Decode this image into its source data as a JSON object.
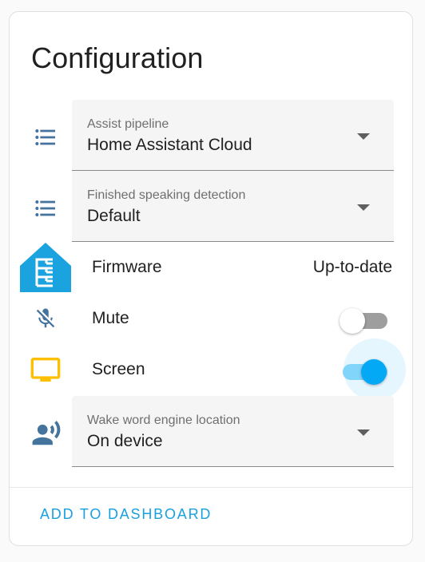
{
  "card": {
    "title": "Configuration"
  },
  "assist_pipeline": {
    "label": "Assist pipeline",
    "value": "Home Assistant Cloud",
    "icon": "format-list-bulleted-icon"
  },
  "finished_speaking": {
    "label": "Finished speaking detection",
    "value": "Default",
    "icon": "format-list-bulleted-icon"
  },
  "firmware": {
    "label": "Firmware",
    "value": "Up-to-date",
    "icon": "esphome-icon"
  },
  "mute": {
    "label": "Mute",
    "state": "off",
    "icon": "microphone-off-icon"
  },
  "screen": {
    "label": "Screen",
    "state": "on",
    "icon": "monitor-icon"
  },
  "wake_word": {
    "label": "Wake word engine location",
    "value": "On device",
    "icon": "account-voice-icon"
  },
  "actions": {
    "add_to_dashboard": "ADD TO DASHBOARD"
  },
  "colors": {
    "icon": "#44739e",
    "esphome": "#1ba3df",
    "screen_icon": "#fdbf00",
    "accent": "#03a9f4",
    "button": "#1aa0e0"
  }
}
